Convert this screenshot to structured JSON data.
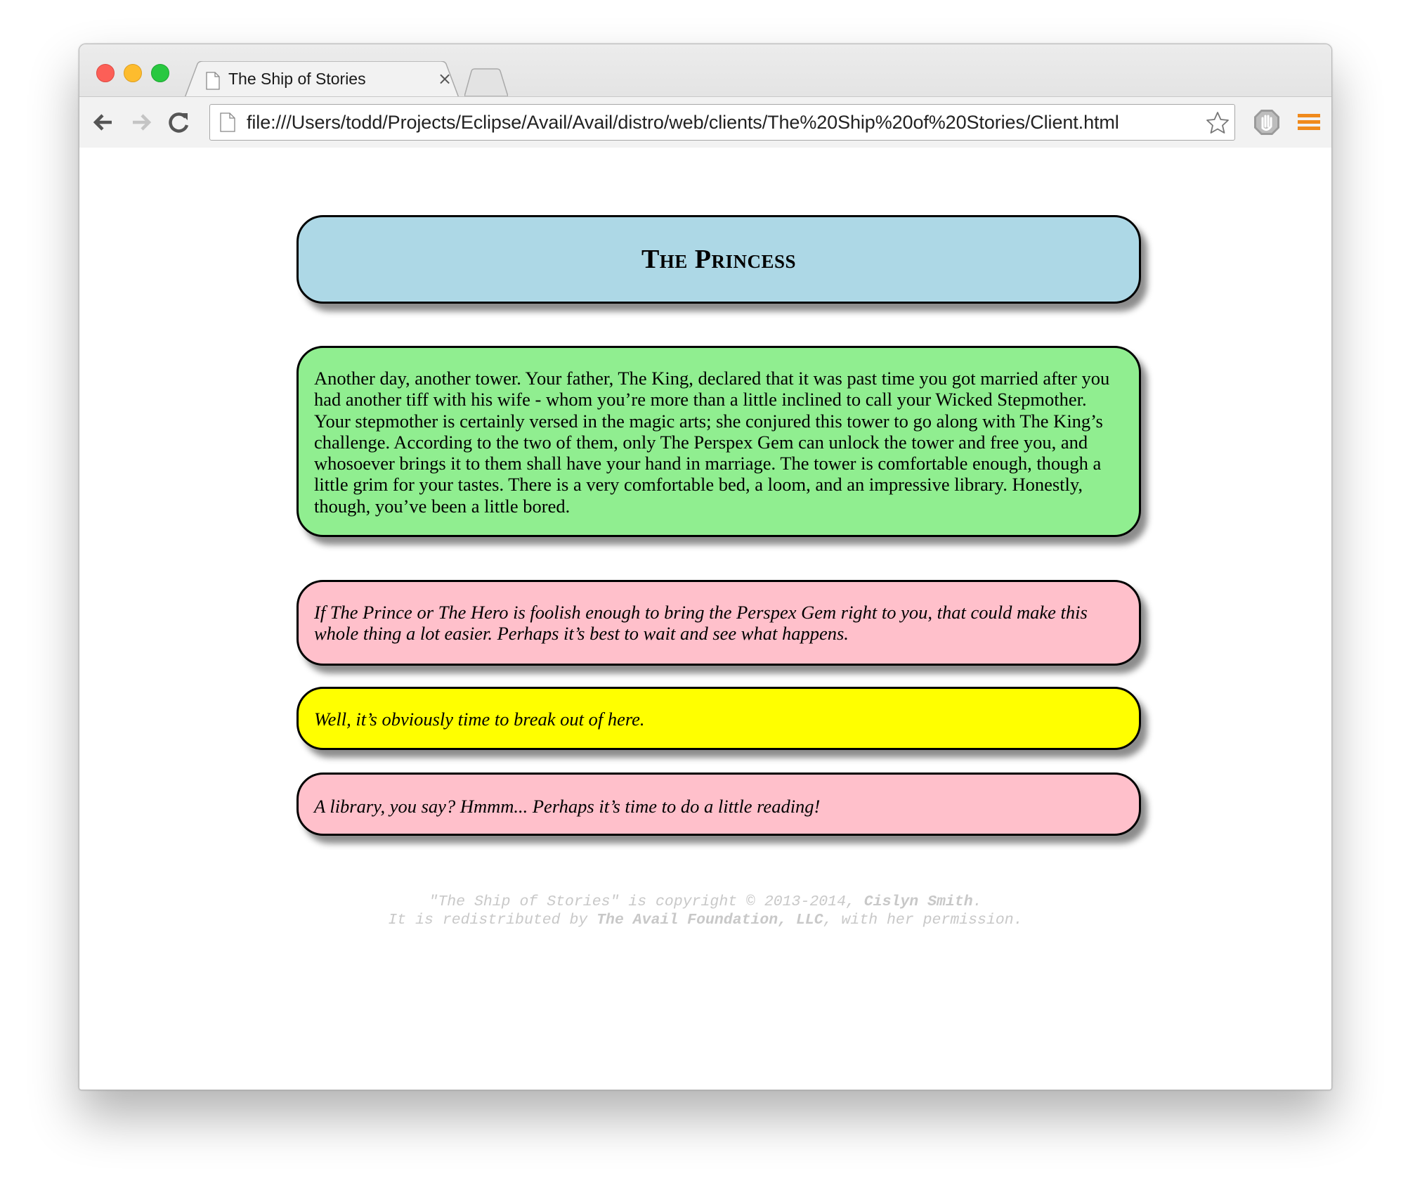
{
  "browser": {
    "tab": {
      "title": "The Ship of Stories",
      "close_glyph": "×"
    },
    "address_bar": {
      "url": "file:///Users/todd/Projects/Eclipse/Avail/Avail/distro/web/clients/The%20Ship%20of%20Stories/Client.html"
    },
    "icons": [
      "back-arrow-icon",
      "forward-arrow-icon",
      "reload-icon",
      "page-icon",
      "bookmark-star-icon",
      "stop-hand-icon",
      "menu-icon"
    ]
  },
  "story": {
    "title": "The Princess",
    "narrative": "Another day, another tower. Your father, The King, declared that it was past time you got married after you had another tiff with his wife - whom you’re more than a little inclined to call your Wicked Stepmother. Your stepmother is certainly versed in the magic arts; she conjured this tower to go along with The King’s challenge. According to the two of them, only The Perspex Gem can unlock the tower and free you, and whosoever brings it to them shall have your hand in marriage. The tower is comfortable enough, though a little grim for your tastes. There is a very comfortable bed, a loom, and an impressive library. Honestly, though, you’ve been a little bored.",
    "choices": [
      {
        "text": "If The Prince or The Hero is foolish enough to bring the Perspex Gem right to you, that could make this whole thing a lot easier. Perhaps it’s best to wait and see what happens.",
        "color": "#ffc0cb"
      },
      {
        "text": "Well, it’s obviously time to break out of here.",
        "color": "#ffff00"
      },
      {
        "text": "A library, you say? Hmmm... Perhaps it’s time to do a little reading!",
        "color": "#ffc0cb"
      }
    ],
    "title_color": "#add8e6",
    "narrative_color": "#90ee90"
  },
  "footer": {
    "line1_pre": "\"The Ship of Stories\" is copyright © 2013-2014, ",
    "line1_bold": "Cislyn Smith",
    "line1_post": ".",
    "line2_pre": "It is redistributed by ",
    "line2_bold": "The Avail Foundation, LLC",
    "line2_post": ", with her permission."
  }
}
